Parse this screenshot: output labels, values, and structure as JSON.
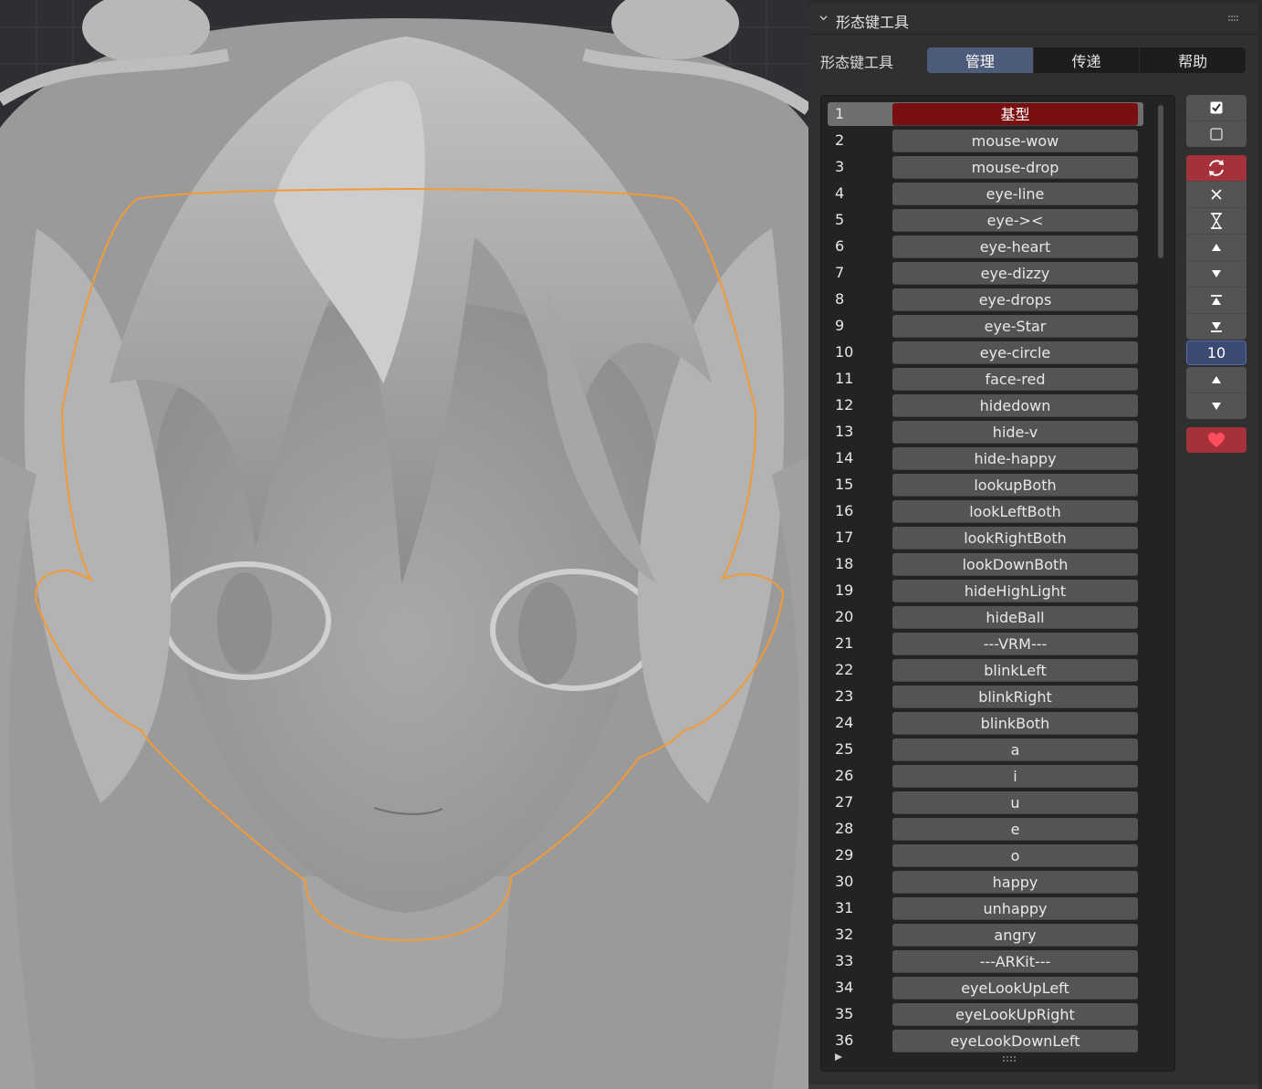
{
  "panel": {
    "title": "形态键工具",
    "tool_label": "形态键工具",
    "tabs": [
      {
        "label": "管理",
        "active": true
      },
      {
        "label": "传递",
        "active": false
      },
      {
        "label": "帮助",
        "active": false
      }
    ]
  },
  "shape_keys": [
    {
      "index": "1",
      "name": "基型",
      "selected": true
    },
    {
      "index": "2",
      "name": "mouse-wow"
    },
    {
      "index": "3",
      "name": "mouse-drop"
    },
    {
      "index": "4",
      "name": "eye-line"
    },
    {
      "index": "5",
      "name": "eye-><"
    },
    {
      "index": "6",
      "name": "eye-heart"
    },
    {
      "index": "7",
      "name": "eye-dizzy"
    },
    {
      "index": "8",
      "name": "eye-drops"
    },
    {
      "index": "9",
      "name": "eye-Star"
    },
    {
      "index": "10",
      "name": "eye-circle"
    },
    {
      "index": "11",
      "name": "face-red"
    },
    {
      "index": "12",
      "name": "hidedown"
    },
    {
      "index": "13",
      "name": "hide-v"
    },
    {
      "index": "14",
      "name": "hide-happy"
    },
    {
      "index": "15",
      "name": "lookupBoth"
    },
    {
      "index": "16",
      "name": "lookLeftBoth"
    },
    {
      "index": "17",
      "name": "lookRightBoth"
    },
    {
      "index": "18",
      "name": "lookDownBoth"
    },
    {
      "index": "19",
      "name": "hideHighLight"
    },
    {
      "index": "20",
      "name": "hideBall"
    },
    {
      "index": "21",
      "name": "---VRM---"
    },
    {
      "index": "22",
      "name": "blinkLeft"
    },
    {
      "index": "23",
      "name": "blinkRight"
    },
    {
      "index": "24",
      "name": "blinkBoth"
    },
    {
      "index": "25",
      "name": "a"
    },
    {
      "index": "26",
      "name": "i"
    },
    {
      "index": "27",
      "name": "u"
    },
    {
      "index": "28",
      "name": "e"
    },
    {
      "index": "29",
      "name": "o"
    },
    {
      "index": "30",
      "name": "happy"
    },
    {
      "index": "31",
      "name": "unhappy"
    },
    {
      "index": "32",
      "name": "angry"
    },
    {
      "index": "33",
      "name": "---ARKit---"
    },
    {
      "index": "34",
      "name": "eyeLookUpLeft"
    },
    {
      "index": "35",
      "name": "eyeLookUpRight"
    },
    {
      "index": "36",
      "name": "eyeLookDownLeft"
    }
  ],
  "side_buttons": {
    "count_value": "10",
    "select_all_icon": "checkbox-checked-icon",
    "deselect_all_icon": "checkbox-empty-icon",
    "refresh_icon": "refresh-icon",
    "remove_icon": "close-icon",
    "hourglass_icon": "hourglass-icon",
    "move_up_icon": "triangle-up-icon",
    "move_down_icon": "triangle-down-icon",
    "move_top_icon": "move-top-icon",
    "move_bottom_icon": "move-bottom-icon",
    "heart_icon": "heart-icon"
  },
  "colors": {
    "accent_active_tab": "#4d5c7a",
    "selected_key": "#7a0f12",
    "refresh_button": "#a5313b",
    "selection_outline": "#f29a38",
    "count_field": "#3b4a72"
  }
}
